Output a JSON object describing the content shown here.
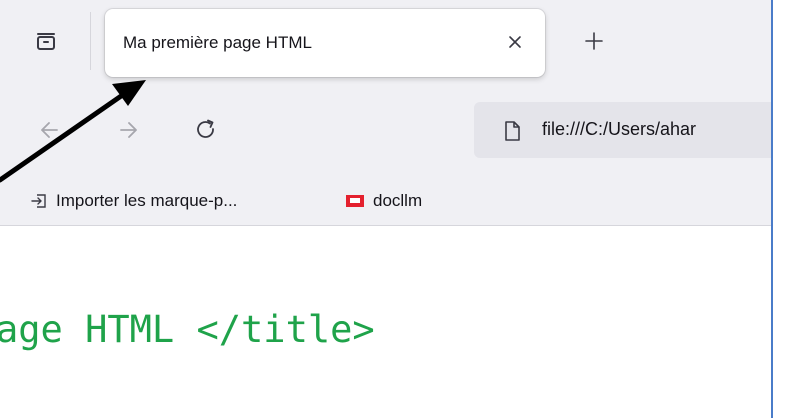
{
  "tabs": [
    {
      "title": "Ma première page HTML",
      "active": true
    }
  ],
  "tabstrip": {
    "list_tabs_icon": "tab-list-icon",
    "new_tab_icon": "plus-icon",
    "close_icon": "close-icon"
  },
  "navigation": {
    "back_icon": "arrow-left-icon",
    "forward_icon": "arrow-right-icon",
    "reload_icon": "reload-icon",
    "url": "file:///C:/Users/ahar",
    "url_icon": "file-icon"
  },
  "bookmarks": [
    {
      "label": "Importer les marque-p...",
      "icon": "import-icon"
    },
    {
      "label": "docllm",
      "icon": "docllm-icon"
    }
  ],
  "content": {
    "code_text": "age HTML </title>"
  },
  "colors": {
    "code_text": "#1fa34a",
    "frame_border": "#4a7cc9",
    "docllm_icon": "#e4202e"
  }
}
